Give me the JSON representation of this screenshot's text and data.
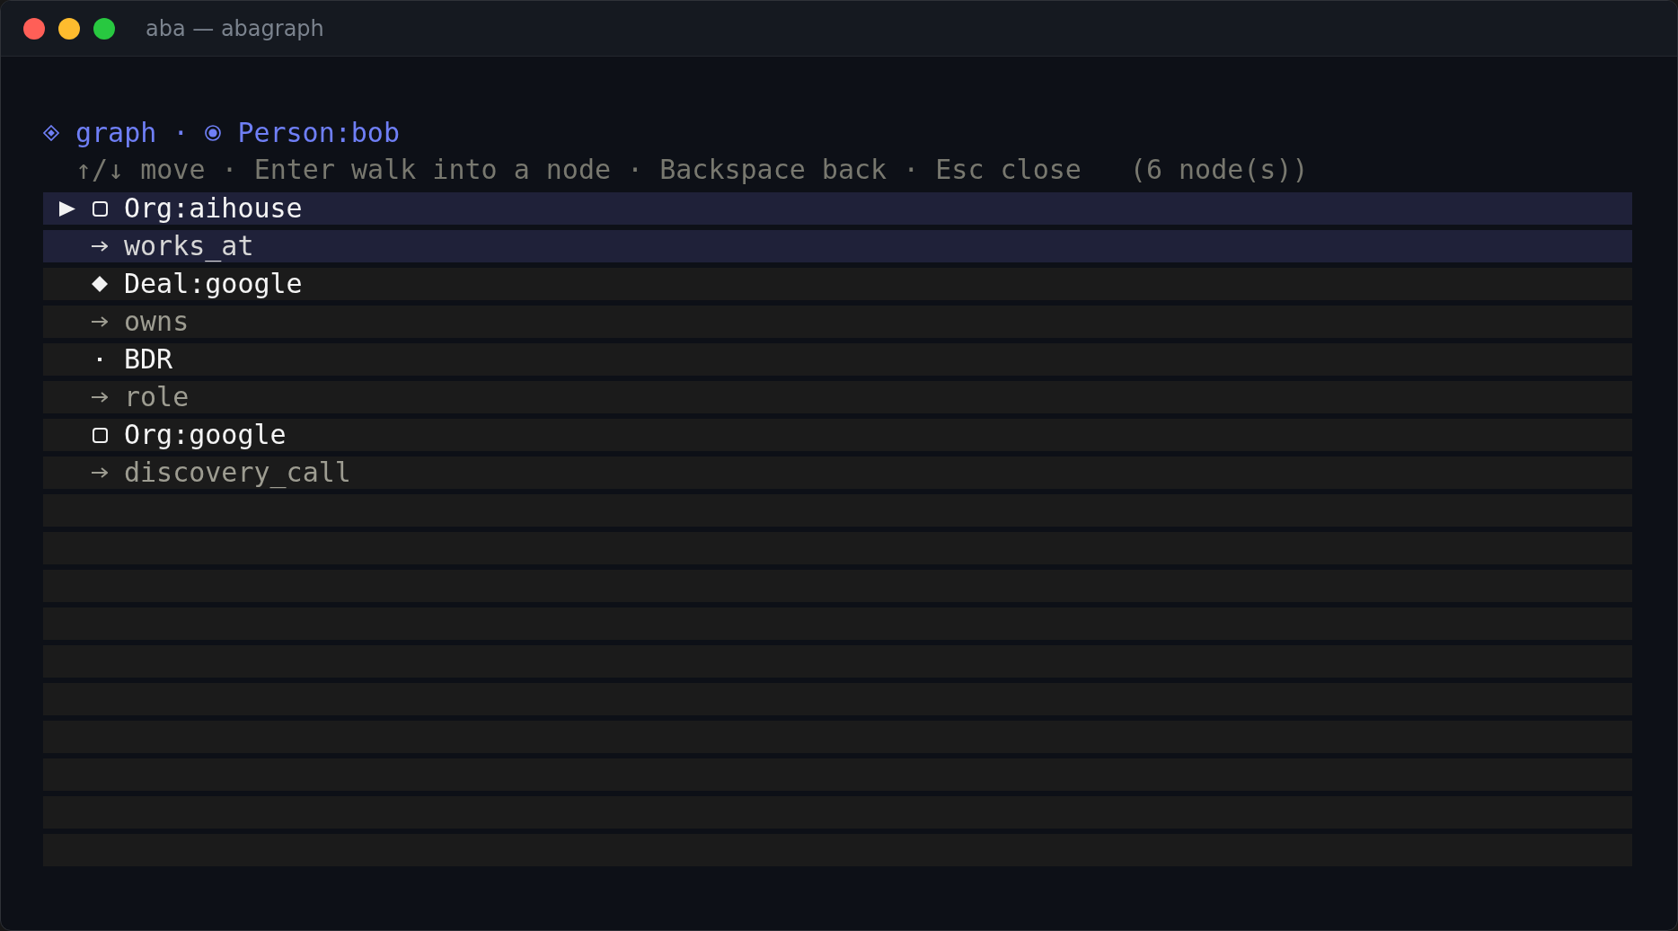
{
  "window": {
    "title": "aba — abagraph"
  },
  "breadcrumb": {
    "items": [
      {
        "label": "graph"
      },
      {
        "label": "Person:bob"
      }
    ],
    "separator": "·"
  },
  "help": {
    "keys": "↑/↓ move · Enter walk into a node · Backspace back · Esc close",
    "count": "(6 node(s))"
  },
  "rows": [
    {
      "kind": "org",
      "label": "Org:aihouse",
      "selected": true,
      "cursor": true
    },
    {
      "kind": "edge",
      "label": "works_at",
      "selected": true,
      "cursor": false
    },
    {
      "kind": "deal",
      "label": "Deal:google",
      "selected": false,
      "cursor": false
    },
    {
      "kind": "edge",
      "label": "owns",
      "selected": false,
      "cursor": false
    },
    {
      "kind": "value",
      "label": "BDR",
      "selected": false,
      "cursor": false
    },
    {
      "kind": "edge",
      "label": "role",
      "selected": false,
      "cursor": false
    },
    {
      "kind": "org",
      "label": "Org:google",
      "selected": false,
      "cursor": false
    },
    {
      "kind": "edge",
      "label": "discovery_call",
      "selected": false,
      "cursor": false
    },
    {
      "kind": "blank"
    },
    {
      "kind": "blank"
    },
    {
      "kind": "blank"
    },
    {
      "kind": "blank"
    },
    {
      "kind": "blank"
    },
    {
      "kind": "blank"
    },
    {
      "kind": "blank"
    },
    {
      "kind": "blank"
    },
    {
      "kind": "blank"
    },
    {
      "kind": "blank"
    }
  ]
}
